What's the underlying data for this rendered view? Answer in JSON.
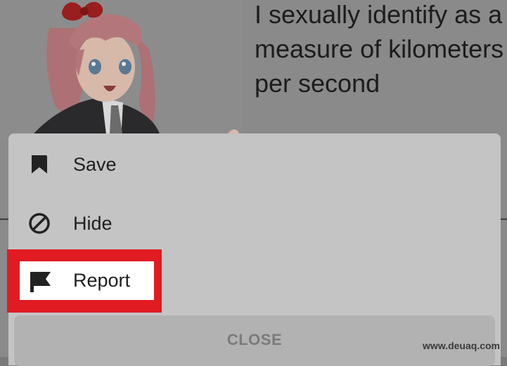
{
  "post": {
    "caption": "I sexually identify as a measure of kilometers per second"
  },
  "menu": {
    "items": [
      {
        "label": "Save",
        "icon": "bookmark-icon"
      },
      {
        "label": "Hide",
        "icon": "hide-icon"
      },
      {
        "label": "Report",
        "icon": "flag-icon"
      }
    ],
    "close_label": "CLOSE"
  },
  "highlight_color": "#e01b22",
  "watermark": "www.deuaq.com"
}
